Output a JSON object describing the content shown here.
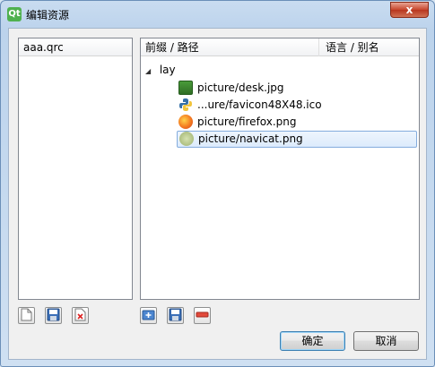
{
  "window": {
    "title": "编辑资源",
    "app_icon_text": "Qt",
    "close_symbol": "x"
  },
  "left_list": {
    "items": [
      "aaa.qrc"
    ]
  },
  "right_list": {
    "columns": [
      "前缀 / 路径",
      "语言 / 别名"
    ],
    "root": {
      "arrow": "◢",
      "label": "lay"
    },
    "files": [
      {
        "label": "picture/desk.jpg",
        "icon": "jpg-image-icon"
      },
      {
        "label": "...ure/favicon48X48.ico",
        "icon": "python-icon"
      },
      {
        "label": "picture/firefox.png",
        "icon": "firefox-icon"
      },
      {
        "label": "picture/navicat.png",
        "icon": "navicat-icon",
        "selected": true
      }
    ]
  },
  "buttons": {
    "ok": "确定",
    "cancel": "取消"
  }
}
